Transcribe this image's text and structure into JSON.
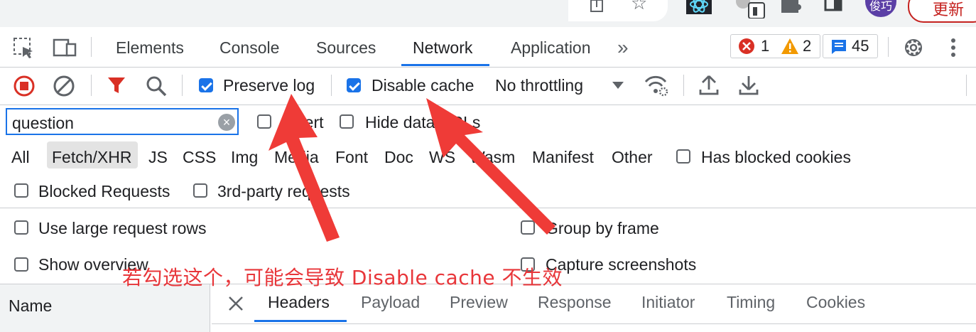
{
  "browser": {
    "update_label": "更新",
    "avatar_text": "俊巧"
  },
  "devtools": {
    "tabs": [
      {
        "label": "Elements"
      },
      {
        "label": "Console"
      },
      {
        "label": "Sources"
      },
      {
        "label": "Network",
        "active": true
      },
      {
        "label": "Application"
      }
    ],
    "more_tabs": "»",
    "errors_count": "1",
    "warnings_count": "2",
    "messages_count": "45"
  },
  "toolbar": {
    "preserve_log": {
      "label": "Preserve log",
      "checked": true
    },
    "disable_cache": {
      "label": "Disable cache",
      "checked": true
    },
    "throttling": "No throttling"
  },
  "filter": {
    "search_value": "question",
    "invert_label": "Invert",
    "hide_data_urls_label": "Hide data URLs",
    "types": [
      "All",
      "Fetch/XHR",
      "JS",
      "CSS",
      "Img",
      "Media",
      "Font",
      "Doc",
      "WS",
      "Wasm",
      "Manifest",
      "Other"
    ],
    "active_type": "Fetch/XHR",
    "has_blocked_cookies_label": "Has blocked cookies",
    "blocked_requests_label": "Blocked Requests",
    "third_party_label": "3rd-party requests"
  },
  "settings": {
    "large_rows_label": "Use large request rows",
    "group_by_frame_label": "Group by frame",
    "show_overview_label": "Show overview",
    "capture_screenshots_label": "Capture screenshots"
  },
  "details": {
    "name_header": "Name",
    "tabs": [
      "Headers",
      "Payload",
      "Preview",
      "Response",
      "Initiator",
      "Timing",
      "Cookies"
    ],
    "active_tab": "Headers"
  },
  "annotation": {
    "text": "若勾选这个，可能会导致 Disable cache 不生效",
    "color": "#e8363a"
  }
}
